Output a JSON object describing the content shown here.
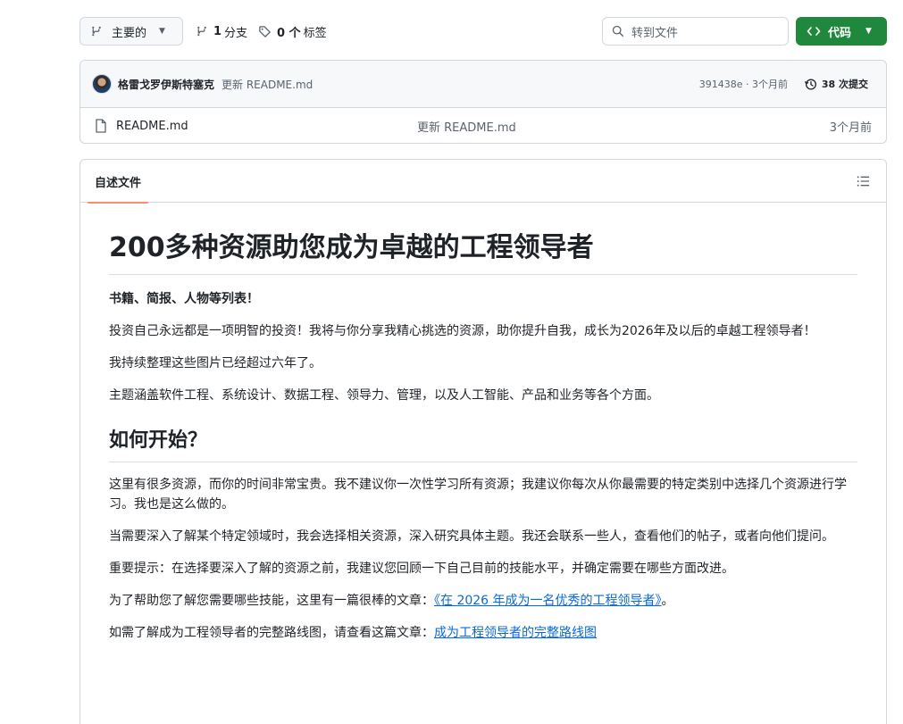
{
  "toolbar": {
    "branch_label": "主要的",
    "branch_count": "1",
    "branch_word": "分支",
    "tag_count": "0 个",
    "tag_word": "标签",
    "search_placeholder": "转到文件",
    "code_label": "代码"
  },
  "commit": {
    "author": "格雷戈罗伊斯特塞克",
    "message": "更新 README.md",
    "sha_age": "391438e · 3个月前",
    "commit_count": "38 次提交"
  },
  "files": [
    {
      "name": "README.md",
      "message": "更新 README.md",
      "age": "3个月前"
    }
  ],
  "readme": {
    "tab_label": "自述文件",
    "title": "200多种资源助您成为卓越的工程领导者",
    "subtitle": "书籍、简报、人物等列表！",
    "p1": "投资自己永远都是一项明智的投资！我将与你分享我精心挑选的资源，助你提升自我，成长为2026年及以后的卓越工程领导者！",
    "p2": "我持续整理这些图片已经超过六年了。",
    "p3": "主题涵盖软件工程、系统设计、数据工程、领导力、管理，以及人工智能、产品和业务等各个方面。",
    "h2": "如何开始？",
    "p4": "这里有很多资源，而你的时间非常宝贵。我不建议你一次性学习所有资源；我建议你每次从你最需要的特定类别中选择几个资源进行学习。我也是这么做的。",
    "p5": "当需要深入了解某个特定领域时，我会选择相关资源，深入研究具体主题。我还会联系一些人，查看他们的帖子，或者向他们提问。",
    "p6": "重要提示：在选择要深入了解的资源之前，我建议您回顾一下自己目前的技能水平，并确定需要在哪些方面改进。",
    "p7_prefix": "为了帮助您了解您需要哪些技能，这里有一篇很棒的文章：",
    "p7_link": "《在 2026 年成为一名优秀的工程领导者》",
    "p7_suffix": "。",
    "p8_prefix": "如需了解成为工程领导者的完整路线图，请查看这篇文章：",
    "p8_link": "成为工程领导者的完整路线图"
  },
  "icons": {
    "branch": "git-branch-icon",
    "tag": "tag-icon",
    "search": "search-icon",
    "code": "code-icon",
    "history": "history-icon",
    "file": "file-icon",
    "outline": "list-unordered-icon"
  },
  "colors": {
    "accent_green": "#1f883d",
    "link_blue": "#0969da",
    "tab_underline": "#fd8c73"
  }
}
